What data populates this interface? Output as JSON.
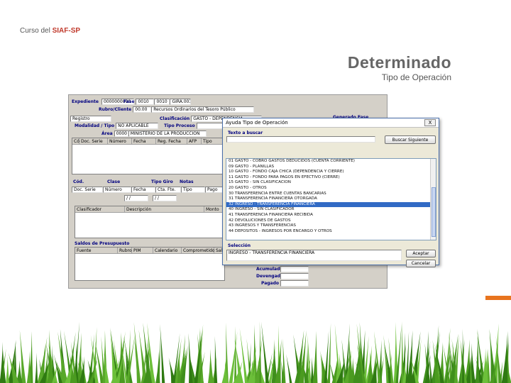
{
  "slide": {
    "course_prefix": "Curso del",
    "course_name": "SIAF-SP",
    "title": "Determinado",
    "subtitle": "Tipo de Operación",
    "accent_color": "#e8741e",
    "grass_color": "#3f8f1c"
  },
  "screenshot": {
    "expediente_label": "Expediente",
    "expediente_value": "0000000000",
    "fase_label": "Fase",
    "fase_value": "0010",
    "fase_code": "0010",
    "fase_name": "GIRA.0030",
    "rubro_label": "Rubro/Cliente",
    "rubro_value": "00.00",
    "rubro_desc": "Recursos Ordinarios del Tesoro Público",
    "registro_label": "Registro",
    "clasif_label": "Clasificación",
    "clasif_value": "GASTO - DEPENDENCIA",
    "generado_label": "Generado Fase",
    "modalidad_label": "Modalidad / Tipo",
    "modalidad_value": "NO APLICABLE",
    "tipo_proceso_label": "Tipo Proceso",
    "area_label": "Área",
    "area_code": "0000",
    "area_value": "MINISTERIO DE LA PRODUCCIÓN",
    "doc_cols": [
      "Cód.",
      "Doc. Serie",
      "Número",
      "Fecha",
      "Reg. Fecha",
      "AFP",
      "Tipo"
    ],
    "mid_cols": [
      "Cód.",
      "Clase",
      "Tipo Giro",
      "Notas"
    ],
    "mid_cols2": [
      "Doc. Serie",
      "Número",
      "Fecha",
      "Cta. Fte.",
      "Tipo",
      "Pago"
    ],
    "mid_date1": "/ /",
    "mid_date2": "/ /",
    "clasif_cols": [
      "Clasificador",
      "Descripción",
      "Monto"
    ],
    "saldos_title": "Saldos de Presupuesto",
    "saldos_cols": [
      "Fuente",
      "Rubro",
      "PIM",
      "Calendario",
      "Comprometido",
      "Saldo"
    ],
    "bottom_labels": [
      "Acumulado",
      "Devengado",
      "Pagado"
    ]
  },
  "dialog": {
    "title": "Ayuda Tipo de Operación",
    "close_label": "X",
    "search_label": "Texto a buscar",
    "find_button": "Buscar Siguiente",
    "items": [
      "01 GASTO - COBRO GASTOS DEDUCIDOS (CUENTA CORRIENTE)",
      "09 GASTO - PLANILLAS",
      "10 GASTO - FONDO CAJA CHICA (DEPENDENCIA Y CIERRE)",
      "11 GASTO - FONDO PARA PAGOS EN EFECTIVO (CIERRE)",
      "15 GASTO - SIN CLASIFICACION",
      "20 GASTO - OTROS",
      "30 TRANSFERENCIA ENTRE CUENTAS BANCARIAS",
      "31 TRANSFERENCIA FINANCIERA OTORGADA",
      "32 INGRESO - TRANSFERENCIA FINANCIERA",
      "40 INGRESO - SIN CLASIFICADOR",
      "41 TRANSFERENCIA FINANCIERA RECIBIDA",
      "42 DEVOLUCIONES DE GASTOS",
      "43 INGRESOS Y TRANSFERENCIAS",
      "44 DEPOSITOS - INGRESOS POR ENCARGO Y OTROS"
    ],
    "selected_index": 8,
    "selection_label": "Selección",
    "selection_value": "INGRESO - TRANSFERENCIA FINANCIERA",
    "accept_button": "Aceptar",
    "cancel_button": "Cancelar"
  }
}
